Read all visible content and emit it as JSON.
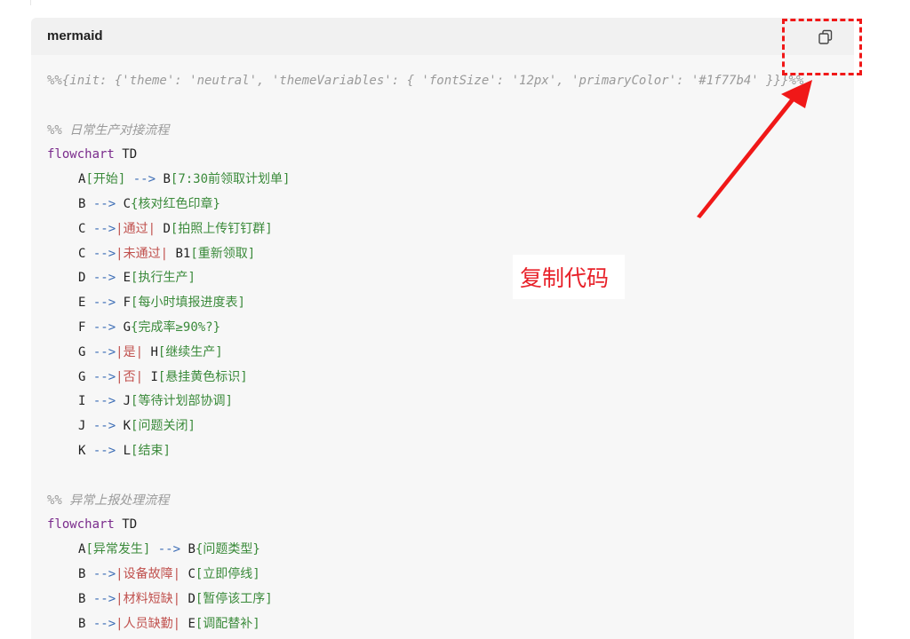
{
  "code_block": {
    "language": "mermaid",
    "copy_icon": "copy-icon",
    "lines": [
      {
        "type": "comment",
        "text": "%%{init: {'theme': 'neutral', 'themeVariables': { 'fontSize': '12px', 'primaryColor': '#1f77b4' }}}%%"
      },
      {
        "type": "blank"
      },
      {
        "type": "comment",
        "text": "%% 日常生产对接流程"
      },
      {
        "type": "keyword",
        "kw": "flowchart",
        "rest": " TD"
      },
      {
        "type": "edge",
        "a": "A",
        "a_label": "[开始]",
        "arrow": " --> ",
        "b": "B",
        "b_label": "[7:30前领取计划单]"
      },
      {
        "type": "edge",
        "a": "B",
        "arrow": " --> ",
        "b": "C",
        "b_label": "{核对红色印章}"
      },
      {
        "type": "edge",
        "a": "C",
        "arrow": " -->",
        "edge_label": "|通过|",
        "b": " D",
        "b_label": "[拍照上传钉钉群]"
      },
      {
        "type": "edge",
        "a": "C",
        "arrow": " -->",
        "edge_label": "|未通过|",
        "b": " B1",
        "b_label": "[重新领取]"
      },
      {
        "type": "edge",
        "a": "D",
        "arrow": " --> ",
        "b": "E",
        "b_label": "[执行生产]"
      },
      {
        "type": "edge",
        "a": "E",
        "arrow": " --> ",
        "b": "F",
        "b_label": "[每小时填报进度表]"
      },
      {
        "type": "edge",
        "a": "F",
        "arrow": " --> ",
        "b": "G",
        "b_label": "{完成率≥90%?}"
      },
      {
        "type": "edge",
        "a": "G",
        "arrow": " -->",
        "edge_label": "|是|",
        "b": " H",
        "b_label": "[继续生产]"
      },
      {
        "type": "edge",
        "a": "G",
        "arrow": " -->",
        "edge_label": "|否|",
        "b": " I",
        "b_label": "[悬挂黄色标识]"
      },
      {
        "type": "edge",
        "a": "I",
        "arrow": " --> ",
        "b": "J",
        "b_label": "[等待计划部协调]"
      },
      {
        "type": "edge",
        "a": "J",
        "arrow": " --> ",
        "b": "K",
        "b_label": "[问题关闭]"
      },
      {
        "type": "edge",
        "a": "K",
        "arrow": " --> ",
        "b": "L",
        "b_label": "[结束]"
      },
      {
        "type": "blank"
      },
      {
        "type": "comment",
        "text": "%% 异常上报处理流程"
      },
      {
        "type": "keyword",
        "kw": "flowchart",
        "rest": " TD"
      },
      {
        "type": "edge",
        "a": "A",
        "a_label": "[异常发生]",
        "arrow": " --> ",
        "b": "B",
        "b_label": "{问题类型}"
      },
      {
        "type": "edge",
        "a": "B",
        "arrow": " -->",
        "edge_label": "|设备故障|",
        "b": " C",
        "b_label": "[立即停线]"
      },
      {
        "type": "edge",
        "a": "B",
        "arrow": " -->",
        "edge_label": "|材料短缺|",
        "b": " D",
        "b_label": "[暂停该工序]"
      },
      {
        "type": "edge",
        "a": "B",
        "arrow": " -->",
        "edge_label": "|人员缺勤|",
        "b": " E",
        "b_label": "[调配替补]"
      }
    ]
  },
  "annotation": {
    "text": "复制代码",
    "color": "#e8222a"
  },
  "colors": {
    "highlight": "#f01818",
    "comment": "#9a9a9a",
    "keyword": "#7a2b8c",
    "label": "#3a8a3a",
    "arrow": "#3b6cb5",
    "edge_label": "#c0504d"
  }
}
